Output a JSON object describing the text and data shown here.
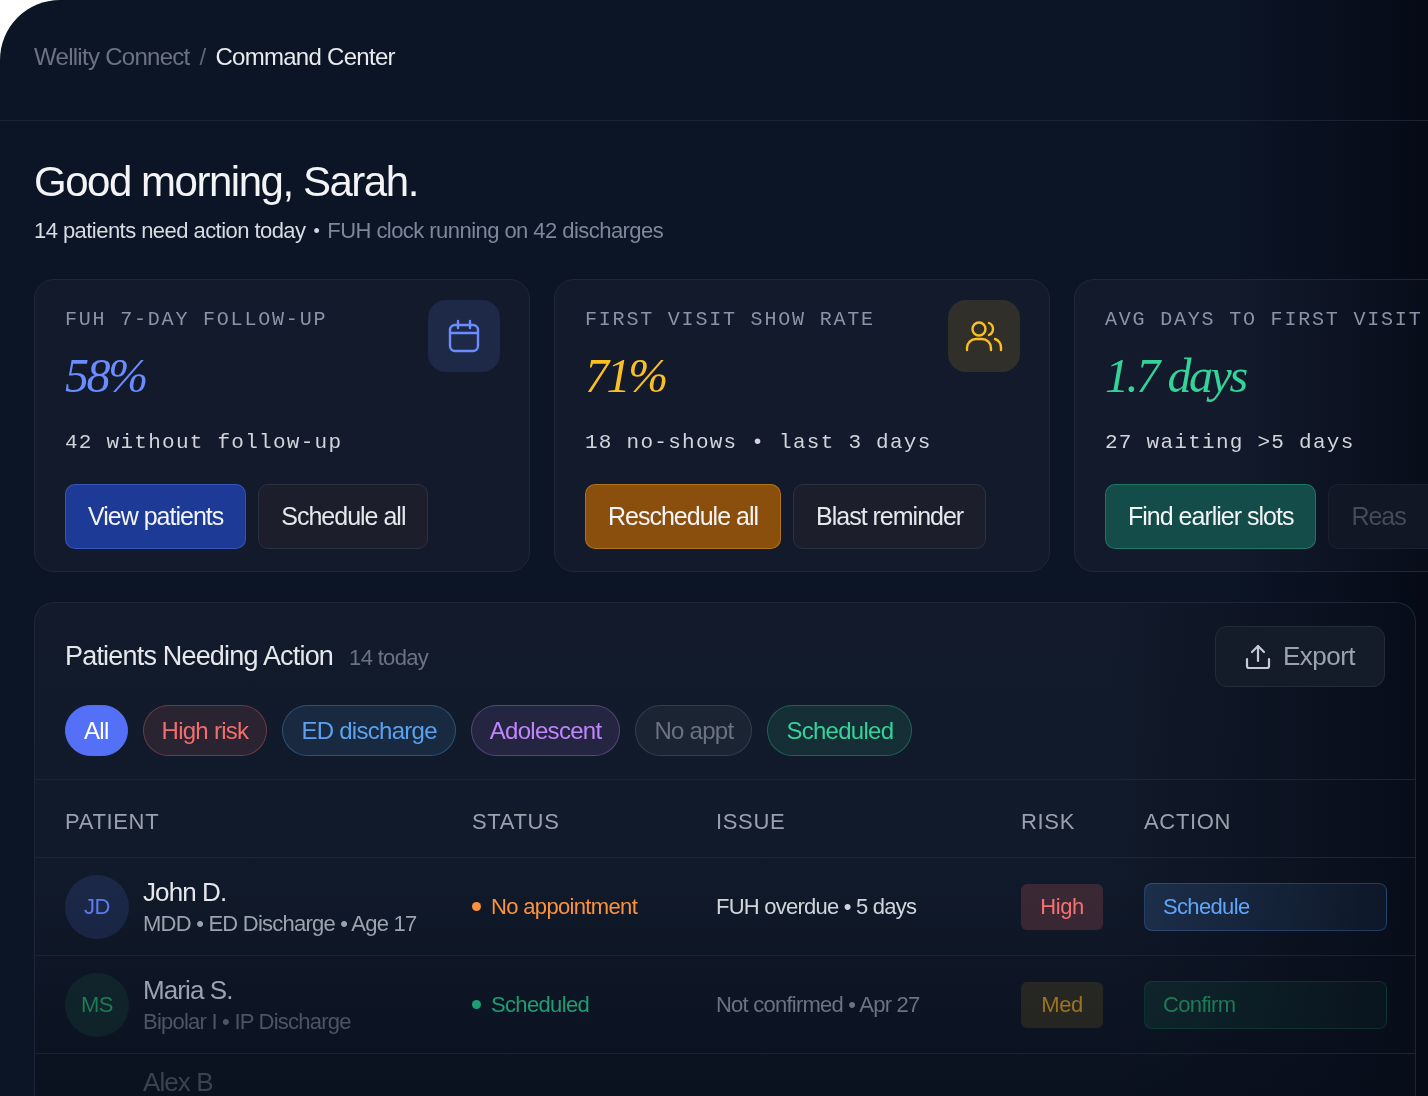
{
  "breadcrumb": {
    "items": [
      {
        "label": "Wellity Connect",
        "current": false
      },
      {
        "label": "Command Center",
        "current": true
      }
    ],
    "separator": "/"
  },
  "greeting": "Good morning, Sarah.",
  "summary": {
    "items": [
      {
        "text": "14 patients need action today",
        "emphasis": true
      },
      {
        "text": "FUH clock running on 42 discharges",
        "emphasis": false
      }
    ],
    "separator": "•"
  },
  "metrics": [
    {
      "label": "FUH 7-DAY FOLLOW-UP",
      "value": "58%",
      "color": "#6b8cff",
      "detail": "42 without follow-up",
      "buttons": [
        {
          "label": "View patients",
          "kind": "primary",
          "color": "#1d3a96"
        },
        {
          "label": "Schedule all",
          "kind": "secondary"
        }
      ]
    },
    {
      "label": "FIRST VISIT SHOW RATE",
      "value": "71%",
      "color": "#fbbf24",
      "detail": "18 no-shows • last 3 days",
      "buttons": [
        {
          "label": "Reschedule all",
          "kind": "primary",
          "color": "#8a4e0d"
        },
        {
          "label": "Blast reminder",
          "kind": "secondary"
        }
      ]
    },
    {
      "label": "AVG DAYS TO FIRST VISIT",
      "value": "1.7 days",
      "color": "#34d399",
      "detail": "27 waiting >5 days",
      "buttons": [
        {
          "label": "Find earlier slots",
          "kind": "primary",
          "color": "#134c48"
        },
        {
          "label": "Reas",
          "kind": "secondary"
        }
      ]
    }
  ],
  "patients_panel": {
    "title": "Patients Needing Action",
    "count": "14 today",
    "export": "Export",
    "filters": [
      {
        "label": "All",
        "selected": true,
        "color": "#5470f6"
      },
      {
        "label": "High risk",
        "selected": false,
        "color": "#f26d6d"
      },
      {
        "label": "ED discharge",
        "selected": false,
        "color": "#5aa2f0"
      },
      {
        "label": "Adolescent",
        "selected": false,
        "color": "#c084fc"
      },
      {
        "label": "No appt",
        "selected": false,
        "color": "#6b7280"
      },
      {
        "label": "Scheduled",
        "selected": false,
        "color": "#34d399"
      }
    ],
    "columns": [
      "PATIENT",
      "STATUS",
      "ISSUE",
      "RISK",
      "ACTION"
    ],
    "rows": [
      {
        "avatar": {
          "initials": "JD",
          "color": "#5b7cf0"
        },
        "name": "John D.",
        "meta": "MDD • ED Discharge • Age 17",
        "status": {
          "text": "No appointment",
          "color": "#fb923c"
        },
        "issue": "FUH overdue • 5 days",
        "risk": {
          "text": "High",
          "color": "#f87171"
        },
        "action": {
          "label": "Schedule",
          "color": "#60a5fa"
        }
      },
      {
        "avatar": {
          "initials": "MS",
          "color": "#1f7a55"
        },
        "name": "Maria S.",
        "meta": "Bipolar I • IP Discharge",
        "status": {
          "text": "Scheduled",
          "color": "#1f9d72"
        },
        "issue": "Not confirmed • Apr 27",
        "risk": {
          "text": "Med",
          "color": "#9a7420"
        },
        "action": {
          "label": "Confirm",
          "color": "#1d7a57"
        }
      },
      {
        "name": "Alex B"
      }
    ]
  }
}
